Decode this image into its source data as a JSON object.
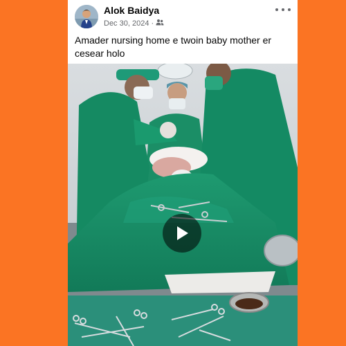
{
  "post": {
    "author": "Alok Baidya",
    "date": "Dec 30, 2024",
    "separator": "·",
    "audience_icon": "friends-icon",
    "caption": "Amader nursing home e twoin baby mother er cesear holo"
  },
  "video": {
    "scene": "operating-room",
    "play_icon": "play-icon"
  },
  "colors": {
    "background": "#fb7423",
    "card": "#ffffff",
    "surgical_green": "#1f8f6a",
    "meta_text": "#65676b"
  }
}
